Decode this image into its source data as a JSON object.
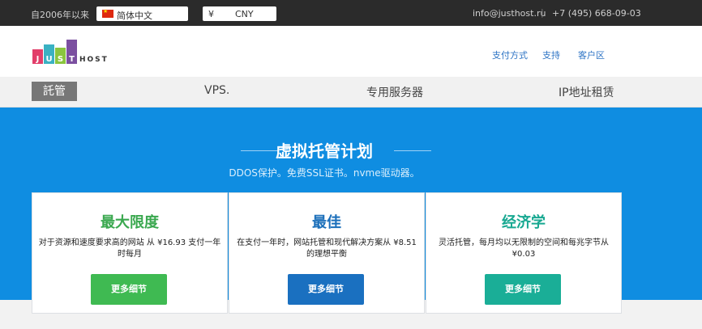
{
  "topbar": {
    "since": "自2006年以来",
    "language": "简体中文",
    "currency_symbol": "¥",
    "currency_code": "CNY",
    "email": "info@justhost.ru",
    "separator": "|",
    "phone": "+7 (495) 668-09-03"
  },
  "logo": {
    "letters": [
      "J",
      "U",
      "S",
      "T"
    ],
    "word": "HOST",
    "colors": [
      "#e23e6a",
      "#3ab1c2",
      "#8ac53e",
      "#7b4fa0"
    ]
  },
  "header_nav": [
    "支付方式",
    "支持",
    "客户区"
  ],
  "main_nav": {
    "active": "託管",
    "items": [
      "VPS.",
      "专用服务器",
      "IP地址租赁"
    ]
  },
  "hero": {
    "title": "虚拟托管计划",
    "subtitle": "DDOS保护。免费SSL证书。nvme驱动器。"
  },
  "plans": [
    {
      "title": "最大限度",
      "title_color": "#3aa84f",
      "description": "对于资源和速度要求高的网站 从 ¥16.93 支付一年时每月",
      "button": "更多细节",
      "button_color": "#3fba52"
    },
    {
      "title": "最佳",
      "title_color": "#1b6fba",
      "description": "在支付一年时，网站托管和现代解决方案从 ¥8.51的理想平衡",
      "button": "更多细节",
      "button_color": "#1a70c0"
    },
    {
      "title": "经济学",
      "title_color": "#17a891",
      "description": "灵活托管，每月均以无限制的空间和每兆字节从 ¥0.03",
      "button": "更多细节",
      "button_color": "#1aae97"
    }
  ]
}
